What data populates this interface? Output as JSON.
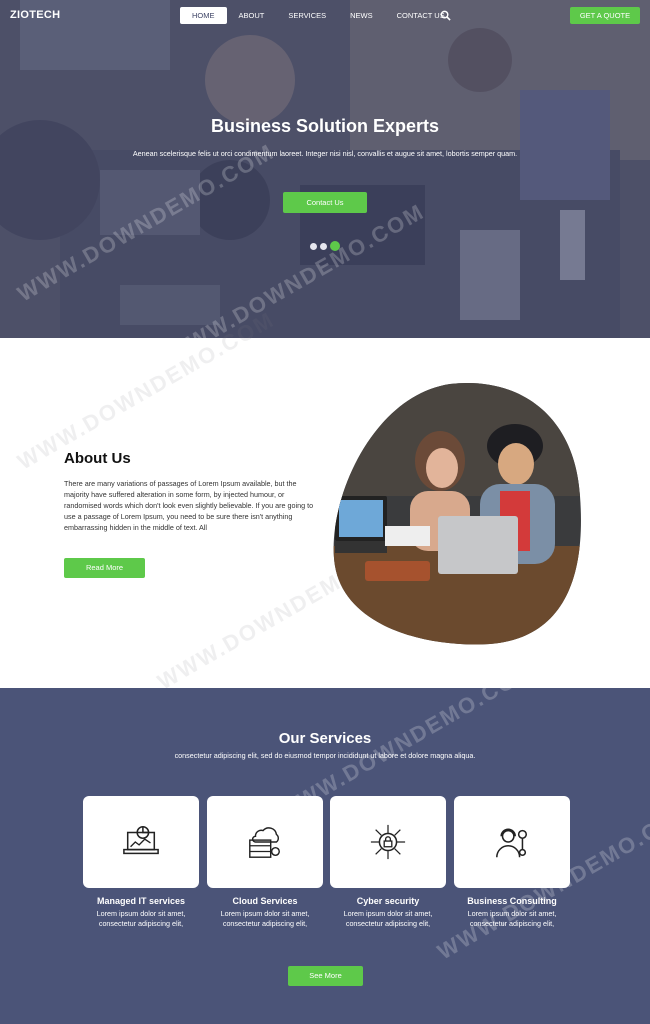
{
  "brand": {
    "logo": "ZIOTECH"
  },
  "nav": {
    "items": [
      "HOME",
      "ABOUT",
      "SERVICES",
      "NEWS",
      "CONTACT US"
    ],
    "active": "HOME",
    "quote_label": "GET A QUOTE"
  },
  "hero": {
    "title": "Business Solution Experts",
    "subtitle": "Aenean scelerisque felis ut orci condimentum laoreet. Integer nisi nisl, convallis et augue sit amet, lobortis semper quam.",
    "button": "Contact Us",
    "slides": 3,
    "active_slide": 3
  },
  "about": {
    "title": "About Us",
    "text": "There are many variations of passages of Lorem Ipsum available, but the majority have suffered alteration in some form, by injected humour, or randomised words which don't look even slightly believable. If you are going to use a passage of Lorem Ipsum, you need to be sure there isn't anything embarrassing hidden in the middle of text. All",
    "button": "Read More"
  },
  "services": {
    "title": "Our Services",
    "subtitle": "consectetur adipiscing elit, sed do eiusmod tempor incididunt ut labore et dolore magna aliqua.",
    "items": [
      {
        "name": "Managed IT services",
        "desc": "Lorem ipsum dolor sit amet, consectetur adipiscing elit,",
        "icon": "laptop-chart-icon"
      },
      {
        "name": "Cloud Services",
        "desc": "Lorem ipsum dolor sit amet, consectetur adipiscing elit,",
        "icon": "cloud-server-icon"
      },
      {
        "name": "Cyber security",
        "desc": "Lorem ipsum dolor sit amet, consectetur adipiscing elit,",
        "icon": "chip-lock-icon"
      },
      {
        "name": "Business Consulting",
        "desc": "Lorem ipsum dolor sit amet, consectetur adipiscing elit,",
        "icon": "consultant-gear-icon"
      }
    ],
    "button": "See More"
  },
  "watermark": "WWW.DOWNDEMO.COM",
  "colors": {
    "accent": "#5ec94a",
    "services_bg": "#4b5478",
    "hero_overlay": "#464a6e"
  }
}
